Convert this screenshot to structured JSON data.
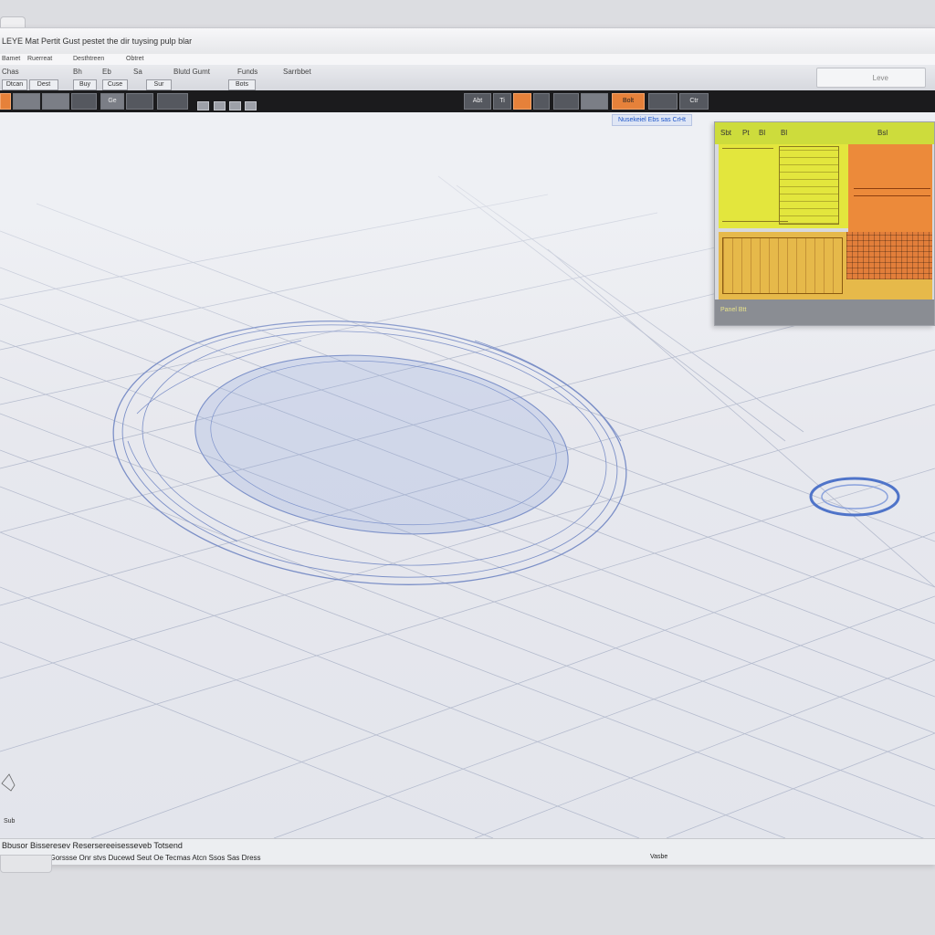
{
  "window": {
    "title": "LEYE Mat Pertit Gust pestet the dir tuysing pulp blar"
  },
  "menubar": {
    "items": [
      "Bamet",
      "Ruerreat",
      "Desthtreen",
      "Obtret"
    ]
  },
  "ribbon": {
    "row1": [
      "Chas",
      "Bh",
      "Eb",
      "Sa",
      "Blutd Gumt",
      "Funds",
      "Sarrbbet"
    ],
    "row2": [
      "Dtcan",
      "Dest",
      "Buy",
      "Cuse",
      "Sur",
      "Bots"
    ],
    "search_label": "Leve"
  },
  "iconbar": {
    "buttons": [
      "Ge",
      "Abt",
      "Ti",
      "Bolt",
      "Ctr"
    ]
  },
  "viewport": {
    "tag": "Nusekeiel Ebs sas CrHt",
    "corner_label": "Sub"
  },
  "panel": {
    "header": [
      "Sbt",
      "Pt",
      "Bl",
      "Bl",
      "Bsl"
    ],
    "footer_label": "Panel Btt"
  },
  "statusbar": {
    "line1": "Bbusor Bisseresev Resersereeisesseveb Totsend",
    "line2": "Buebsns Oaid Gorssse Onr stvs Ducewd Seut Oe Tecmas Atcn Ssos   Sas Dress",
    "right": "Vasbe"
  },
  "colors": {
    "accent_orange": "#e6813a",
    "panel_yellow": "#e3e63d",
    "wire_blue": "#6f87c9"
  }
}
